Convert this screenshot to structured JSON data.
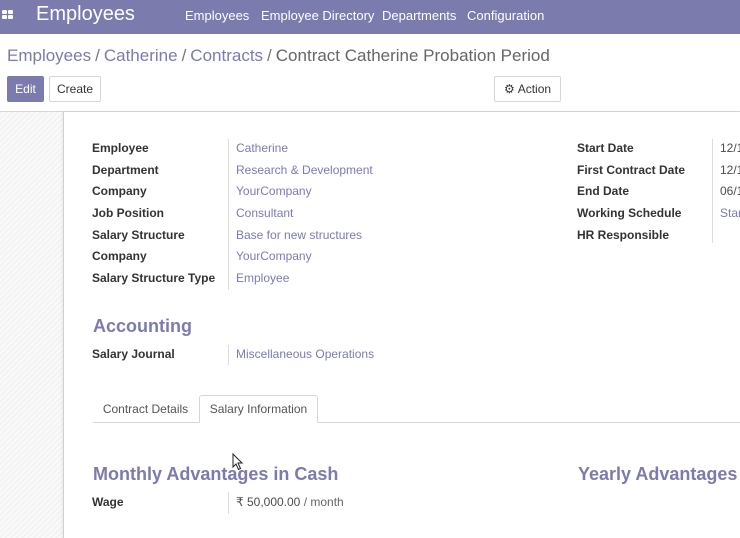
{
  "navbar": {
    "brand": "Employees",
    "items": [
      "Employees",
      "Employee Directory",
      "Departments",
      "Configuration"
    ]
  },
  "breadcrumb": {
    "items": [
      "Employees",
      "Catherine",
      "Contracts"
    ],
    "current": "Contract Catherine Probation Period"
  },
  "toolbar": {
    "edit_label": "Edit",
    "create_label": "Create",
    "action_label": "Action"
  },
  "left_fields": [
    {
      "label": "Employee",
      "value": "Catherine"
    },
    {
      "label": "Department",
      "value": "Research & Development"
    },
    {
      "label": "Company",
      "value": "YourCompany"
    },
    {
      "label": "Job Position",
      "value": "Consultant"
    },
    {
      "label": "Salary Structure",
      "value": "Base for new structures"
    },
    {
      "label": "Company",
      "value": "YourCompany"
    },
    {
      "label": "Salary Structure Type",
      "value": "Employee"
    }
  ],
  "right_fields": [
    {
      "label": "Start Date",
      "value": "12/1"
    },
    {
      "label": "First Contract Date",
      "value": "12/1"
    },
    {
      "label": "End Date",
      "value": "06/1"
    },
    {
      "label": "Working Schedule",
      "value": "Star"
    },
    {
      "label": "HR Responsible",
      "value": ""
    }
  ],
  "accounting": {
    "title": "Accounting",
    "label": "Salary Journal",
    "value": "Miscellaneous Operations"
  },
  "tabs": [
    {
      "label": "Contract Details",
      "active": false
    },
    {
      "label": "Salary Information",
      "active": true
    }
  ],
  "monthly": {
    "title": "Monthly Advantages in Cash",
    "wage_label": "Wage",
    "wage_value": "₹ 50,000.00",
    "wage_unit": "/ month"
  },
  "yearly": {
    "title": "Yearly Advantages"
  },
  "icons": {
    "apps": "apps-grid-icon",
    "action": "gear-icon",
    "cursor": "mouse-pointer-icon"
  },
  "colors": {
    "brand": "#7c7bad",
    "text": "#4c4c4c"
  }
}
